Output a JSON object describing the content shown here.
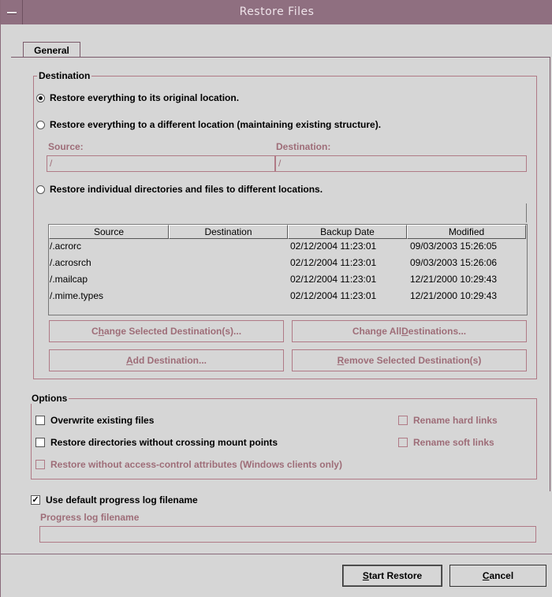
{
  "window": {
    "title": "Restore Files"
  },
  "tabs": [
    {
      "label": "General",
      "selected": true
    }
  ],
  "destination": {
    "legend": "Destination",
    "option_original": "Restore everything to its original location.",
    "option_different": "Restore everything to a different location (maintaining existing structure).",
    "source_label": "Source:",
    "source_value": "/",
    "destination_label": "Destination:",
    "destination_value": "/",
    "option_individual": "Restore individual directories and files to different locations.",
    "selected_option": "original"
  },
  "table": {
    "columns": [
      "Source",
      "Destination",
      "Backup Date",
      "Modified"
    ],
    "rows": [
      {
        "source": "/.acrorc",
        "destination": "",
        "backup_date": "02/12/2004 11:23:01",
        "modified": "09/03/2003 15:26:05"
      },
      {
        "source": "/.acrosrch",
        "destination": "",
        "backup_date": "02/12/2004 11:23:01",
        "modified": "09/03/2003 15:26:06"
      },
      {
        "source": "/.mailcap",
        "destination": "",
        "backup_date": "02/12/2004 11:23:01",
        "modified": "12/21/2000 10:29:43"
      },
      {
        "source": "/.mime.types",
        "destination": "",
        "backup_date": "02/12/2004 11:23:01",
        "modified": "12/21/2000 10:29:43"
      }
    ]
  },
  "buttons": {
    "change_selected_pre": "C",
    "change_selected_u": "h",
    "change_selected_post": "ange Selected Destination(s)...",
    "change_all_pre": "Change All ",
    "change_all_u": "D",
    "change_all_post": "estinations...",
    "add_pre": "",
    "add_u": "A",
    "add_post": "dd Destination...",
    "remove_pre": "",
    "remove_u": "R",
    "remove_post": "emove Selected Destination(s)",
    "start_u": "S",
    "start_post": "tart Restore",
    "cancel_u": "C",
    "cancel_post": "ancel"
  },
  "options": {
    "legend": "Options",
    "overwrite": "Overwrite existing files",
    "no_cross_mount": "Restore directories without crossing mount points",
    "no_acl": "Restore without access-control attributes (Windows clients only)",
    "rename_hard": "Rename hard links",
    "rename_soft": "Rename soft links"
  },
  "progress": {
    "use_default_label": "Use default progress log filename",
    "use_default_checked": true,
    "filename_label": "Progress log filename",
    "filename_value": ""
  }
}
